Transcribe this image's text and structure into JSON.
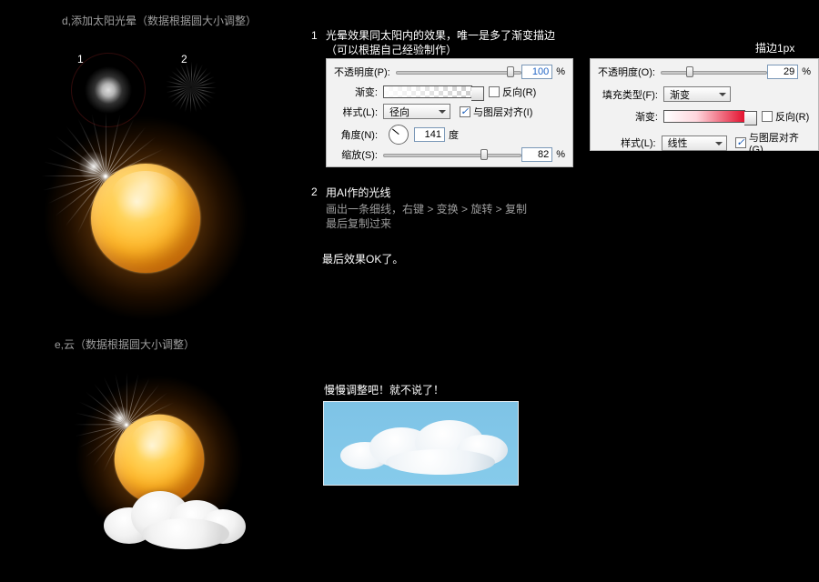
{
  "sectionD": {
    "title": "d,添加太阳光晕（数据根据圆大小调整）",
    "thumb1": "1",
    "thumb2": "2"
  },
  "sectionE": {
    "title": "e,云（数据根据圆大小调整）"
  },
  "right": {
    "num1": "1",
    "line1a": "光晕效果同太阳内的效果，唯一是多了渐变描边",
    "line1b": "（可以根据自己经验制作）",
    "strokeLabel": "描边1px",
    "num2": "2",
    "line2title": "用AI作的光线",
    "line2a": "画出一条细线，右键 > 变换 > 旋转 > 复制",
    "line2b": "最后复制过来",
    "finalOk": "最后效果OK了。",
    "cloudNote": "慢慢调整吧！就不说了！"
  },
  "panelA": {
    "opacityLabel": "不透明度(P):",
    "opacityValue": "100",
    "pct": "%",
    "gradientLabel": "渐变:",
    "reverse": "反向(R)",
    "styleLabel": "样式(L):",
    "styleValue": "径向",
    "alignLayer": "与图层对齐(I)",
    "angleLabel": "角度(N):",
    "angleValue": "141",
    "angleUnit": "度",
    "scaleLabel": "缩放(S):",
    "scaleValue": "82"
  },
  "panelB": {
    "opacityLabel": "不透明度(O):",
    "opacityValue": "29",
    "pct": "%",
    "fillTypeLabel": "填充类型(F):",
    "fillTypeValue": "渐变",
    "gradientLabel": "渐变:",
    "reverse": "反向(R)",
    "styleLabel": "样式(L):",
    "styleValue": "线性",
    "alignLayer": "与图层对齐(G)"
  }
}
